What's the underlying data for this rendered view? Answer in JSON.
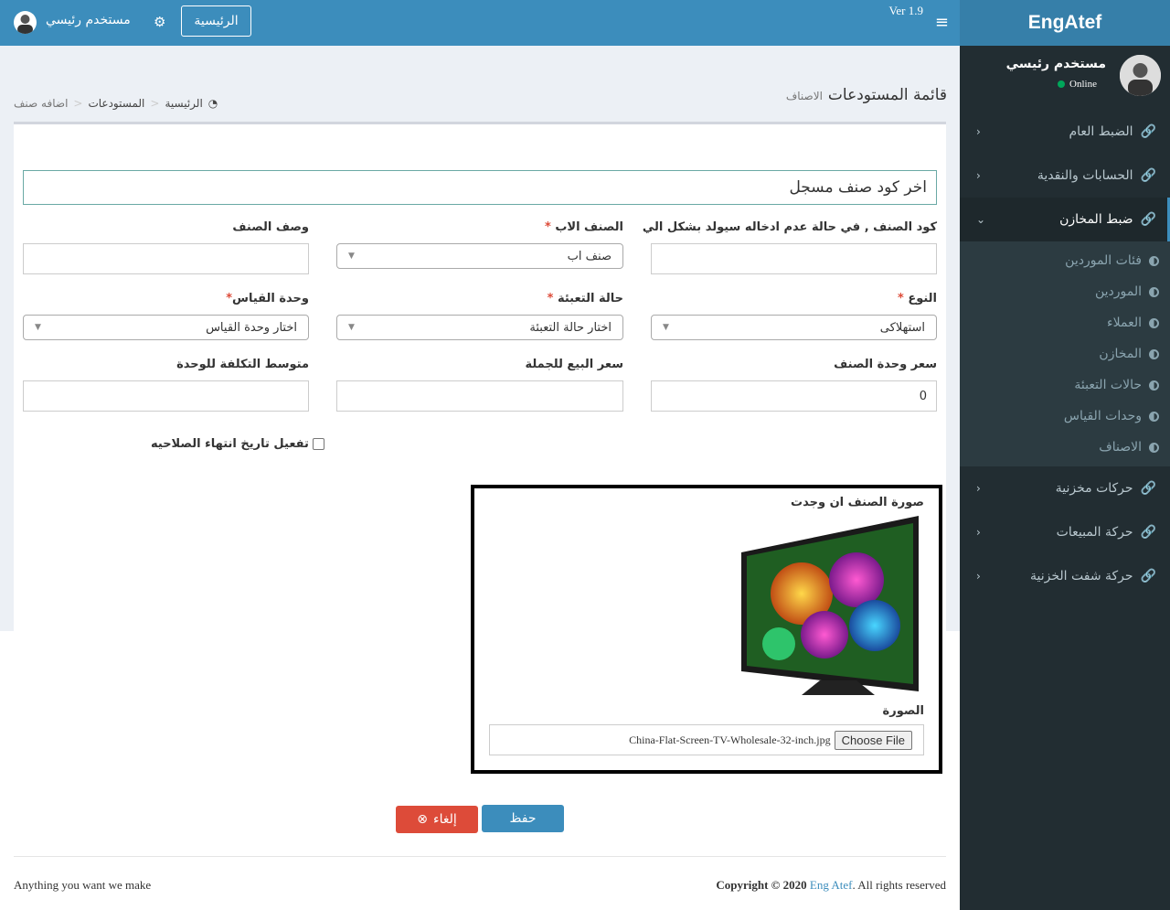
{
  "brand": "EngAtef",
  "version": "Ver 1.9",
  "user": {
    "name": "مستخدم رئيسي",
    "status": "Online"
  },
  "topbar": {
    "home_label": "الرئيسية",
    "user_name": "مستخدم رئيسي"
  },
  "sidebar": {
    "items": [
      {
        "label": "الضبط العام"
      },
      {
        "label": "الحسابات والنقدية"
      },
      {
        "label": "ضبط المخازن"
      },
      {
        "label": "حركات مخزنية"
      },
      {
        "label": "حركة المبيعات"
      },
      {
        "label": "حركة شفت الخزنية"
      }
    ],
    "submenu": [
      {
        "label": "فئات الموردين"
      },
      {
        "label": "الموردين"
      },
      {
        "label": "العملاء"
      },
      {
        "label": "المخازن"
      },
      {
        "label": "حالات التعبئة"
      },
      {
        "label": "وحدات القياس"
      },
      {
        "label": "الاصناف"
      }
    ]
  },
  "header": {
    "title": "قائمة المستودعات",
    "subtitle": "الاصناف",
    "breadcrumb": [
      "الرئيسية",
      "المستودعات",
      "اضافه صنف"
    ]
  },
  "form": {
    "last_code": "اخر كود صنف مسجل",
    "code_label": "كود الصنف , في حالة عدم ادخاله سيولد بشكل الي",
    "parent_label": "الصنف الاب",
    "parent_value": "صنف اب",
    "desc_label": "وصف الصنف",
    "type_label": "النوع",
    "type_value": "استهلاكى",
    "pack_label": "حالة التعبئة",
    "pack_value": "اختار حالة التعبئة",
    "unit_label": "وحدة القياس",
    "unit_value": "اختار وحدة القياس",
    "price_label": "سعر وحدة الصنف",
    "price_value": "0",
    "wholesale_label": "سعر البيع للجملة",
    "avgcost_label": "متوسط التكلفة للوحدة",
    "expiry_label": "تفعيل تاريخ انتهاء الصلاحيه",
    "image_title": "صورة الصنف ان وجدت",
    "image_label": "الصورة",
    "file_name": "China-Flat-Screen-TV-Wholesale-32-inch.jpg",
    "choose_file": "Choose File",
    "save": "حفظ",
    "cancel": "إلغاء"
  },
  "footer": {
    "left": "Anything you want we make",
    "copyright_prefix": "Copyright © 2020",
    "copyright_name": "Eng Atef",
    "copyright_suffix": ". All rights reserved"
  }
}
